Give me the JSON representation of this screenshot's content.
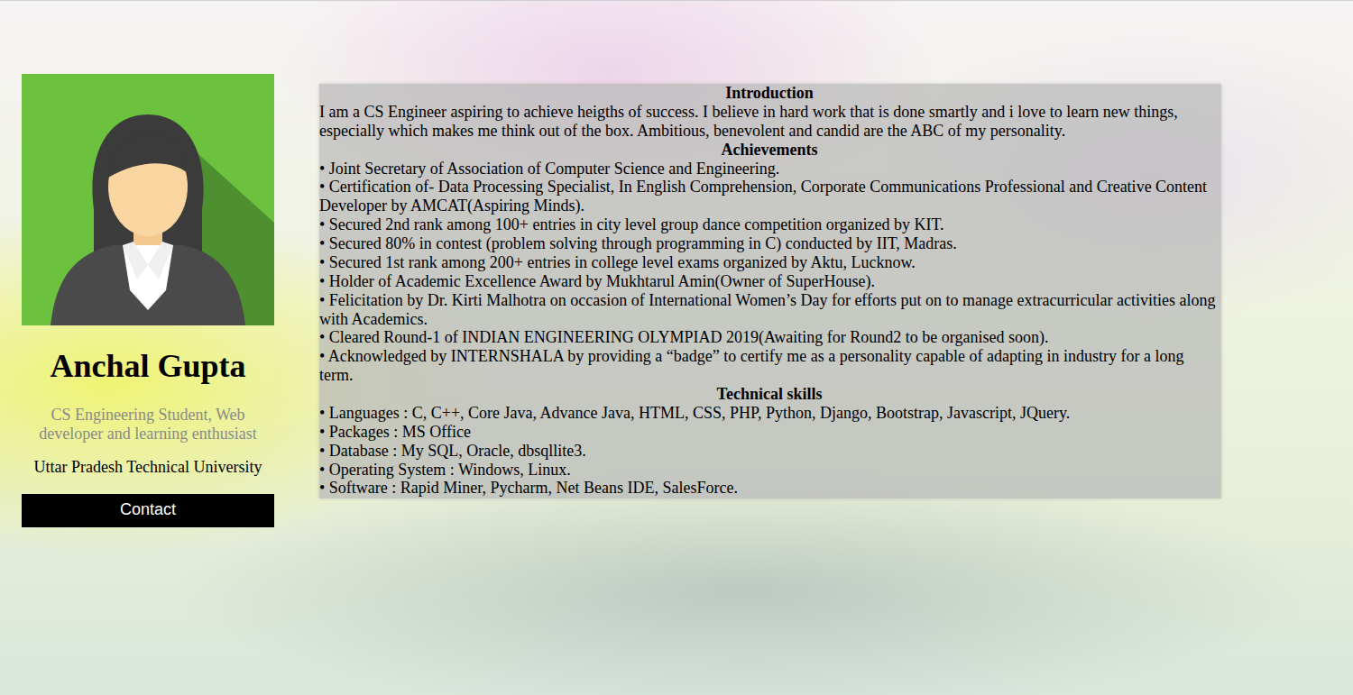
{
  "profile": {
    "name": "Anchal Gupta",
    "subtitle": "CS Engineering Student, Web developer and learning enthusiast",
    "university": "Uttar Pradesh Technical University",
    "contact_button": "Contact"
  },
  "sections": [
    {
      "title": "Introduction",
      "kind": "paragraph",
      "items": [
        "I am a CS Engineer aspiring to achieve heigths of success. I believe in hard work that is done smartly and i love to learn new things, especially which makes me think out of the box. Ambitious, benevolent and candid are the ABC of my personality."
      ]
    },
    {
      "title": "Achievements",
      "kind": "list",
      "items": [
        "• Joint Secretary of Association of Computer Science and Engineering.",
        "• Certification of- Data Processing Specialist, In English Comprehension, Corporate Communications Professional and Creative Content Developer by AMCAT(Aspiring Minds).",
        "• Secured 2nd rank among 100+ entries in city level group dance competition organized by KIT.",
        "• Secured 80% in contest (problem solving through programming in C) conducted by IIT, Madras.",
        "• Secured 1st rank among 200+ entries in college level exams organized by Aktu, Lucknow.",
        "• Holder of Academic Excellence Award by Mukhtarul Amin(Owner of SuperHouse).",
        "• Felicitation by Dr. Kirti Malhotra on occasion of International Women’s Day for efforts put on to manage extracurricular activities along with Academics.",
        "• Cleared Round-1 of INDIAN ENGINEERING OLYMPIAD 2019(Awaiting for Round2 to be organised soon).",
        "• Acknowledged by INTERNSHALA by providing a “badge” to certify me as a personality capable of adapting in industry for a long term."
      ]
    },
    {
      "title": "Technical skills",
      "kind": "list",
      "items": [
        "• Languages : C, C++, Core Java, Advance Java, HTML, CSS, PHP, Python, Django, Bootstrap, Javascript, JQuery.",
        "• Packages : MS Office",
        "• Database : My SQL, Oracle, dbsqllite3.",
        "• Operating System : Windows, Linux.",
        "• Software : Rapid Miner, Pycharm, Net Beans IDE, SalesForce."
      ]
    }
  ]
}
